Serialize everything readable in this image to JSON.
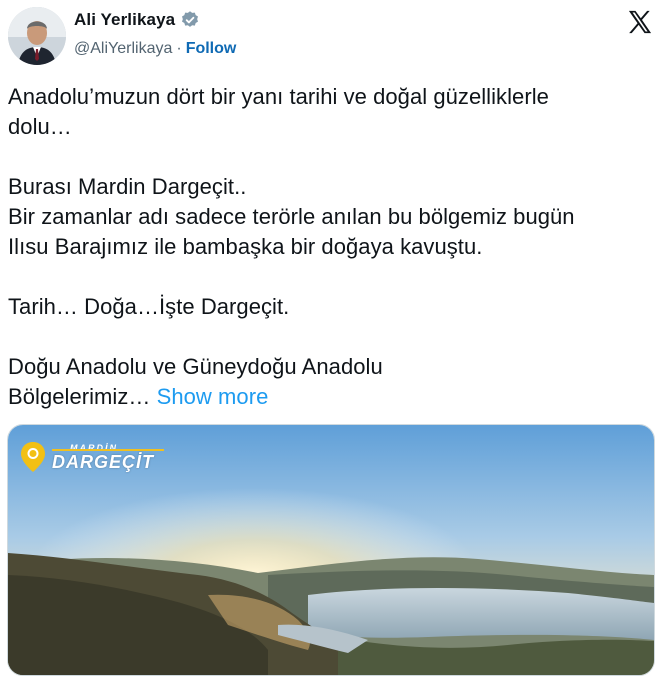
{
  "author": {
    "display_name": "Ali Yerlikaya",
    "handle": "@AliYerlikaya",
    "separator": "·",
    "follow_label": "Follow",
    "verified_color": "#829aab"
  },
  "tweet": {
    "lines": [
      "Anadolu’muzun dört bir yanı tarihi ve doğal güzelliklerle",
      "dolu…",
      "",
      "Burası Mardin Dargeçit..",
      "Bir zamanlar adı sadece terörle anılan bu bölgemiz bugün",
      "Ilısu Barajımız ile bambaşka bir doğaya kavuştu.",
      "",
      "Tarih… Doğa…İşte Dargeçit.",
      "",
      "Doğu Anadolu ve Güneydoğu Anadolu"
    ],
    "last_line": "Bölgelerimiz…",
    "show_more": "Show more"
  },
  "media": {
    "badge_small": "MARDİN",
    "badge_big": "DARGEÇİT",
    "pin_color": "#f2c014"
  },
  "colors": {
    "link": "#1d9bf0",
    "follow": "#0f6ab4",
    "secondary_text": "#536471"
  },
  "icons": {
    "platform": "x-logo-icon",
    "verified": "verified-badge-icon",
    "location": "location-pin-icon"
  }
}
